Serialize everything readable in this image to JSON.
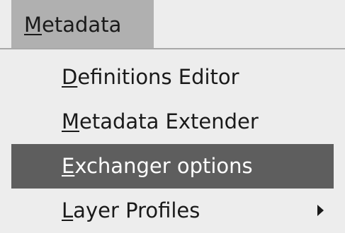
{
  "menubar": {
    "active_menu": {
      "mnemonic": "M",
      "rest": "etadata"
    }
  },
  "menu": {
    "items": [
      {
        "mnemonic": "D",
        "rest": "efinitions Editor",
        "highlighted": false,
        "has_submenu": false
      },
      {
        "mnemonic": "M",
        "rest": "etadata Extender",
        "highlighted": false,
        "has_submenu": false
      },
      {
        "mnemonic": "E",
        "rest": "xchanger options",
        "highlighted": true,
        "has_submenu": false
      },
      {
        "mnemonic": "L",
        "rest": "ayer Profiles",
        "highlighted": false,
        "has_submenu": true,
        "submenu_icon": "triangle-right-icon"
      }
    ]
  }
}
